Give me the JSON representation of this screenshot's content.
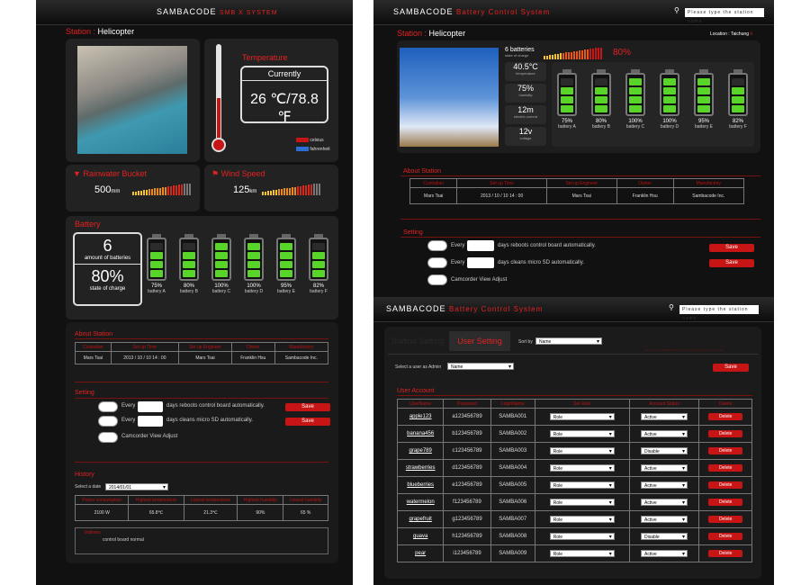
{
  "left": {
    "brand": "SAMBACODE",
    "system": "SMB X SYSTEM",
    "station_label": "Station :",
    "station_name": "Helicopter",
    "temperature": {
      "title": "Temperature",
      "currently": "Currently",
      "value": "26 ℃/78.8 ℉",
      "legend": [
        {
          "label": "celsius",
          "color": "#c71414"
        },
        {
          "label": "fahrenheit",
          "color": "#2a6fd6"
        }
      ]
    },
    "rain": {
      "title": "Rainwater Bucket",
      "value": "500",
      "unit": "mm"
    },
    "wind": {
      "title": "Wind Speed",
      "value": "125",
      "unit": "km"
    },
    "battery": {
      "title": "Battery",
      "count": "6",
      "count_label": "amount of batteries",
      "charge": "80%",
      "charge_label": "state of charge",
      "cells": [
        {
          "pct": "75%",
          "name": "battery A",
          "level": 0.75
        },
        {
          "pct": "80%",
          "name": "battery B",
          "level": 0.8
        },
        {
          "pct": "100%",
          "name": "battery C",
          "level": 1
        },
        {
          "pct": "100%",
          "name": "battery D",
          "level": 1
        },
        {
          "pct": "95%",
          "name": "battery E",
          "level": 0.95
        },
        {
          "pct": "82%",
          "name": "battery F",
          "level": 0.82
        }
      ]
    },
    "about": {
      "title": "About Station",
      "headers": [
        "Custodian",
        "Set up Time",
        "Set up Engineer",
        "Owner",
        "Manufactory"
      ],
      "row": [
        "Mars Tsai",
        "2013 / 10 / 10  14 : 00",
        "Mars Tsai",
        "Franklin Hsu",
        "Sambacode Inc."
      ]
    },
    "setting": {
      "title": "Setting",
      "rows": [
        {
          "pre": "Every",
          "post": "days reboots control board automatically.",
          "save": "Save"
        },
        {
          "pre": "Every",
          "post": "days cleans micro SD automatically.",
          "save": "Save"
        }
      ],
      "camcorder": "Camcorder View Adjust"
    },
    "history": {
      "title": "History",
      "date_label": "Select a date",
      "date_value": "2014/01/01",
      "headers": [
        "Power consumption",
        "Highest temperature",
        "Lowest temperature",
        "Highest humidity",
        "Lowest humidity"
      ],
      "row": [
        "2100 W",
        "65.8℃",
        "21.3℃",
        "90%",
        "65 %"
      ],
      "indexes_label": "Indexes",
      "indexes_value": "control board normal"
    }
  },
  "right_top": {
    "brand": "SAMBACODE",
    "system": "Battery Control System",
    "search_placeholder": "Please type the station name",
    "station_label": "Station :",
    "station_name": "Helicopter",
    "location": "Location : Taichung",
    "batteries": "6 batteries",
    "state_label": "state of charge",
    "charge": "80%",
    "stats": [
      {
        "value": "40.5°C",
        "label": "temperature"
      },
      {
        "value": "75%",
        "label": "humidity"
      },
      {
        "value": "12m",
        "label": "electric current"
      },
      {
        "value": "12v",
        "label": "voltage"
      }
    ],
    "cells": [
      {
        "pct": "75%",
        "name": "battery A",
        "level": 0.75
      },
      {
        "pct": "80%",
        "name": "battery B",
        "level": 0.8
      },
      {
        "pct": "100%",
        "name": "battery C",
        "level": 1
      },
      {
        "pct": "100%",
        "name": "battery D",
        "level": 1
      },
      {
        "pct": "95%",
        "name": "battery E",
        "level": 0.95
      },
      {
        "pct": "82%",
        "name": "battery F",
        "level": 0.82
      }
    ],
    "about": {
      "title": "About Station",
      "headers": [
        "Custodian",
        "Set up Time",
        "Set up Engineer",
        "Owner",
        "Manufactory"
      ],
      "row": [
        "Mars Tsai",
        "2013 / 10 / 10  14 : 00",
        "Mars Tsai",
        "Franklin Hsu",
        "Sambacode Inc."
      ]
    },
    "setting": {
      "title": "Setting",
      "rows": [
        {
          "pre": "Every",
          "post": "days reboots control board automatically.",
          "save": "Save"
        },
        {
          "pre": "Every",
          "post": "days cleans micro SD automatically.",
          "save": "Save"
        }
      ],
      "camcorder": "Camcorder View Adjust"
    }
  },
  "right_bottom": {
    "brand": "SAMBACODE",
    "system": "Battery Control System",
    "search_placeholder": "Please type the station name",
    "tab_inactive": "Station Setting",
    "tab_active": "User Setting",
    "sort_label": "Sort by",
    "sort_value": "Name",
    "notice": "Developed by SAMBACODE Inc. All Rights Reserved Contact Us",
    "admin_label": "Select a user as Admin",
    "admin_value": "Name",
    "save": "Save",
    "user_account": "User Account",
    "headers": [
      "UserName",
      "Password",
      "LoginName",
      "Set Role",
      "Account Status",
      "Delete"
    ],
    "users": [
      {
        "name": "apple123",
        "pwd": "a123456789",
        "login": "SAMBA001",
        "role": "Role",
        "status": "Active"
      },
      {
        "name": "banana456",
        "pwd": "b123456789",
        "login": "SAMBA002",
        "role": "Role",
        "status": "Active"
      },
      {
        "name": "grape789",
        "pwd": "c123456789",
        "login": "SAMBA003",
        "role": "Role",
        "status": "Disable"
      },
      {
        "name": "strawberries",
        "pwd": "d123456789",
        "login": "SAMBA004",
        "role": "Role",
        "status": "Active"
      },
      {
        "name": "blueberries",
        "pwd": "e123456789",
        "login": "SAMBA005",
        "role": "Role",
        "status": "Active"
      },
      {
        "name": "watermelon",
        "pwd": "f123456789",
        "login": "SAMBA006",
        "role": "Role",
        "status": "Active"
      },
      {
        "name": "grapefruit",
        "pwd": "g123456789",
        "login": "SAMBA007",
        "role": "Role",
        "status": "Active"
      },
      {
        "name": "guava",
        "pwd": "h123456789",
        "login": "SAMBA008",
        "role": "Role",
        "status": "Disable"
      },
      {
        "name": "pear",
        "pwd": "i123456789",
        "login": "SAMBA009",
        "role": "Role",
        "status": "Active"
      }
    ],
    "delete_label": "Delete"
  }
}
